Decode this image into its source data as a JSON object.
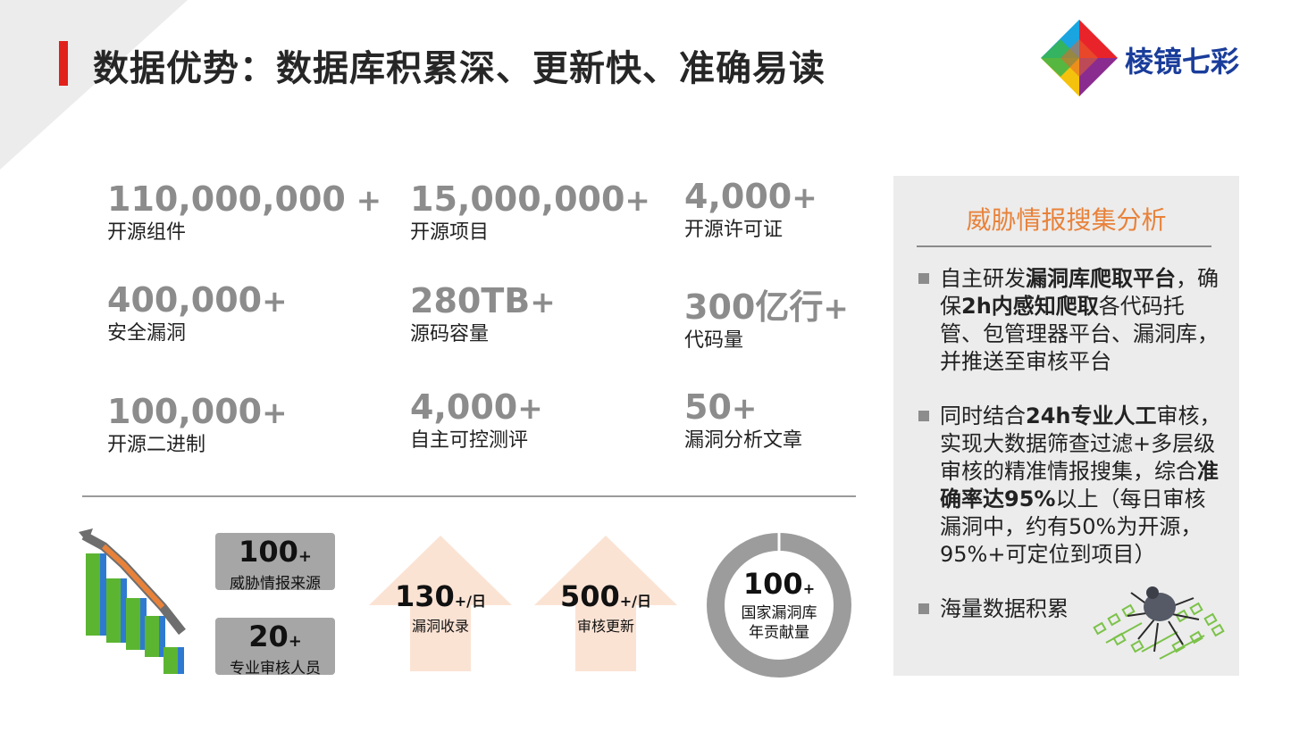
{
  "title": "数据优势：数据库积累深、更新快、准确易读",
  "logo": {
    "text": "棱镜七彩"
  },
  "stats": [
    {
      "num": "110,000,000",
      "suffix": " +",
      "label": "开源组件"
    },
    {
      "num": "15,000,000",
      "suffix": "+",
      "label": "开源项目"
    },
    {
      "num": "4,000",
      "suffix": "+",
      "label": "开源许可证"
    },
    {
      "num": "400,000",
      "suffix": "+",
      "label": "安全漏洞"
    },
    {
      "num": "280TB",
      "suffix": "+",
      "label": "源码容量"
    },
    {
      "num": "300亿行",
      "suffix": "+",
      "label": "代码量"
    },
    {
      "num": "100,000",
      "suffix": "+",
      "label": "开源二进制"
    },
    {
      "num": "4,000",
      "suffix": "+",
      "label": "自主可控测评"
    },
    {
      "num": "50",
      "suffix": "+",
      "label": "漏洞分析文章"
    }
  ],
  "boxes": [
    {
      "num": "100",
      "suffix": "+",
      "label": "威胁情报来源"
    },
    {
      "num": "20",
      "suffix": "+",
      "label": "专业审核人员"
    }
  ],
  "arrows": [
    {
      "num": "130",
      "suffix": "+/日",
      "label": "漏洞收录"
    },
    {
      "num": "500",
      "suffix": "+/日",
      "label": "审核更新"
    }
  ],
  "donut": {
    "num": "100",
    "suffix": "+",
    "label1": "国家漏洞库",
    "label2": "年贡献量"
  },
  "panel": {
    "title": "威胁情报搜集分析",
    "item1": {
      "a": "自主研发",
      "b": "漏洞库爬取平台",
      "c": "，确保",
      "d": "2h内感知爬取",
      "e": "各代码托管、包管理器平台、漏洞库，并推送至审核平台"
    },
    "item2": {
      "a": "同时结合",
      "b": "24h专业人工",
      "c": "审核，实现大数据筛查过滤+多层级审核的精准情报搜集，综合",
      "d": "准确率达95%",
      "e": "以上（每日审核漏洞中，约有50%为开源，95%+可定位到项目）"
    },
    "item3": "海量数据积累"
  },
  "colors": {
    "accent_red": "#e0211c",
    "panel_title": "#e8823a",
    "logo_text": "#1a3d9b",
    "stat_gray": "#8c8c8c"
  }
}
